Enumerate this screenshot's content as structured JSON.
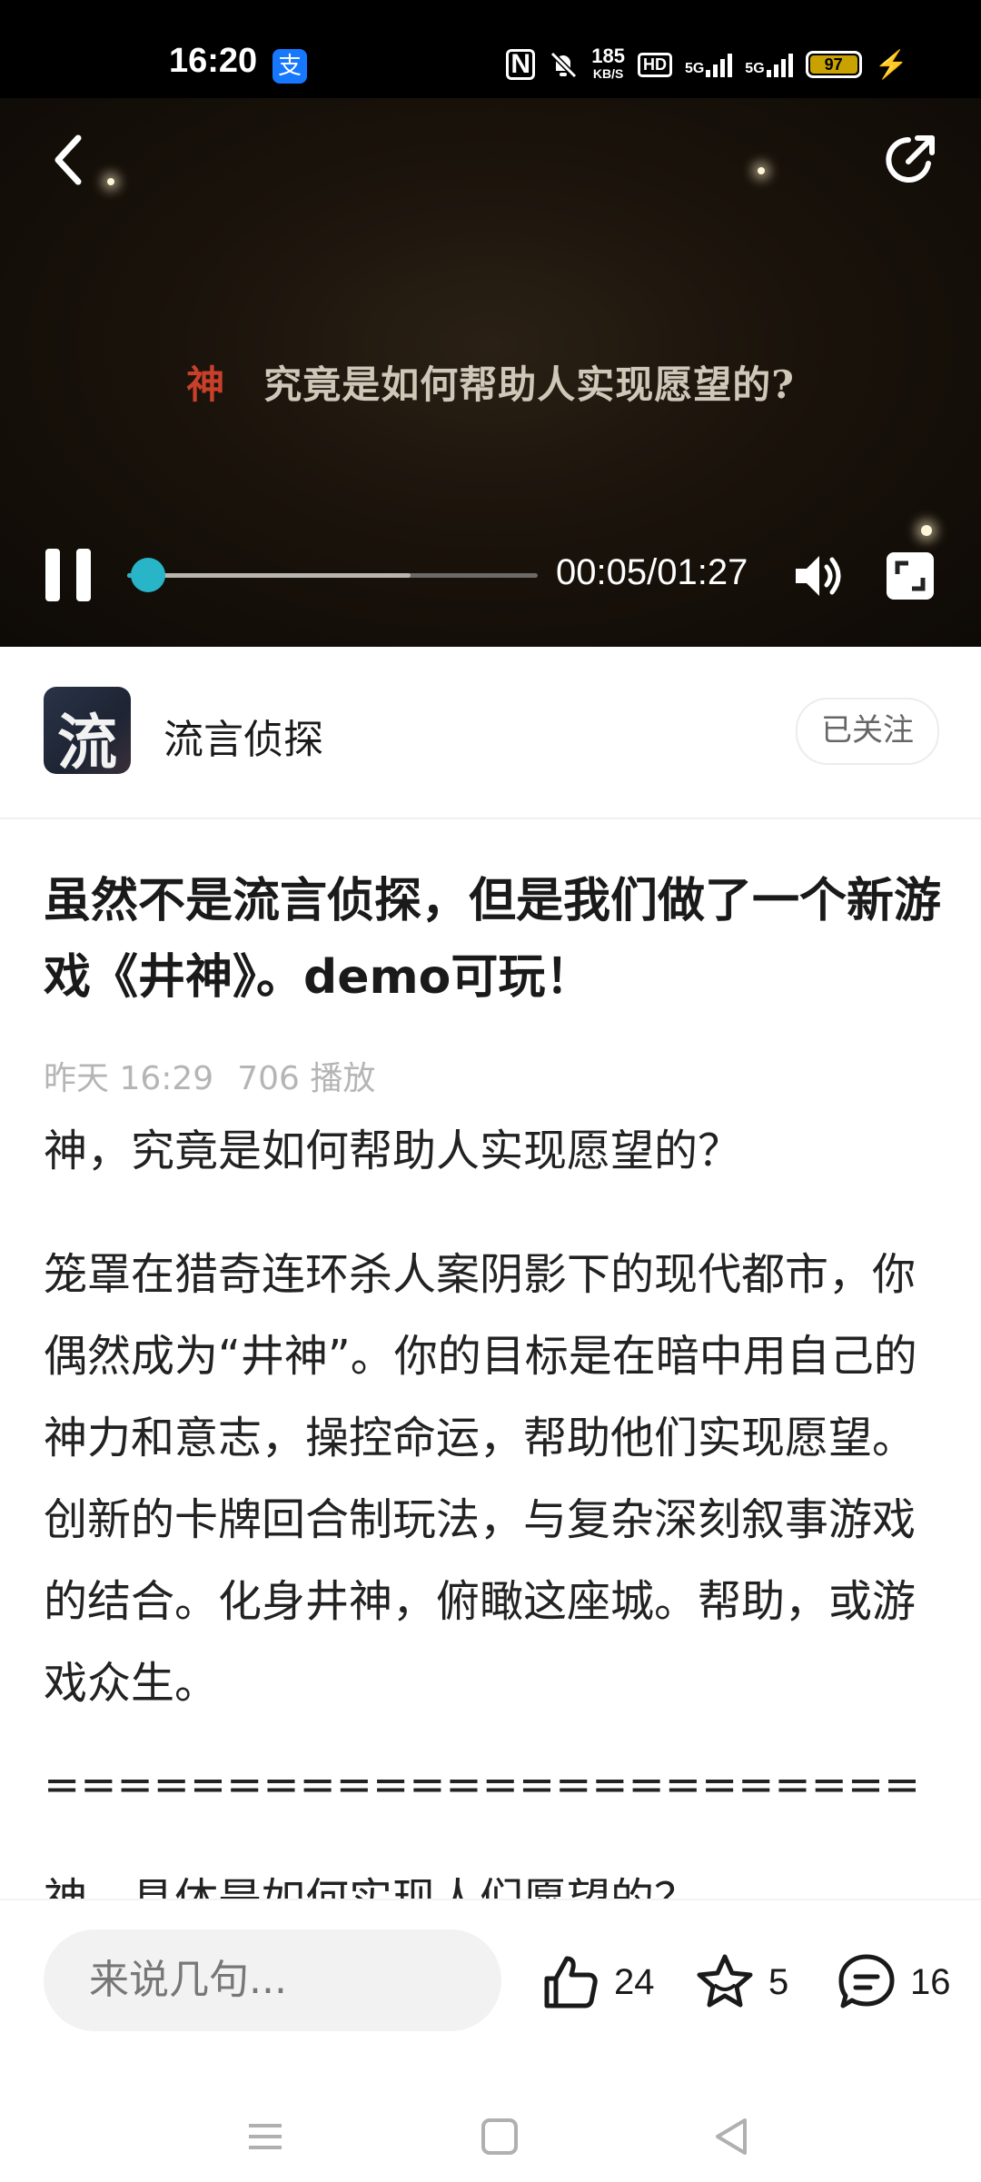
{
  "status_bar": {
    "time": "16:20",
    "app_badge": "支",
    "nfc": "N",
    "speed_top": "185",
    "speed_bottom": "KB/S",
    "hd": "HD",
    "sig1": "5G",
    "sig2": "5G",
    "battery": "97",
    "bolt": "⚡"
  },
  "video": {
    "subtitle_red": "神",
    "subtitle": "究竟是如何帮助人实现愿望的?",
    "time_display": "00:05/01:27",
    "progress_played": 0.05,
    "progress_buffered": 0.69
  },
  "author": {
    "avatar_char": "流",
    "name": "流言侦探",
    "follow_label": "已关注"
  },
  "post": {
    "title": "虽然不是流言侦探，但是我们做了一个新游戏《井神》。demo可玩！",
    "time": "昨天 16:29",
    "plays": "706 播放",
    "p1": "神，究竟是如何帮助人实现愿望的？",
    "p2": "笼罩在猎奇连环杀人案阴影下的现代都市，你偶然成为“井神”。你的目标是在暗中用自己的神力和意志，操控命运，帮助他们实现愿望。创新的卡牌回合制玩法，与复杂深刻叙事游戏的结合。化身井神，俯瞰这座城。帮助，或游戏众生。",
    "separator": "=================================",
    "p3": "神，具体是如何实现人们愿望的？"
  },
  "bottom_bar": {
    "comment_placeholder": "来说几句...",
    "likes": "24",
    "favorites": "5",
    "comments": "16"
  }
}
